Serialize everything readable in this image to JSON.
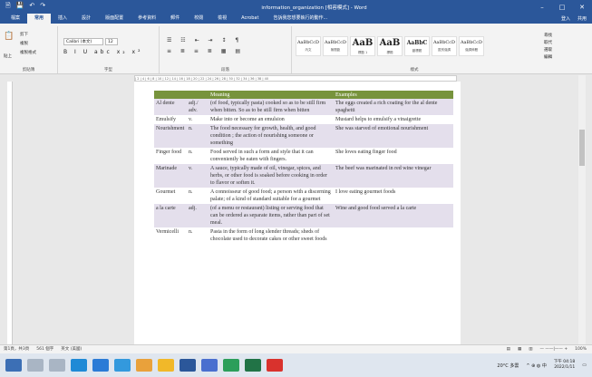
{
  "window": {
    "title": "information_organization [相容模式] - Word",
    "search_placeholder": "告訴我您想要執行的動作..."
  },
  "qat": [
    "🗎",
    "💾",
    "↶",
    "↷"
  ],
  "tabs": [
    "檔案",
    "常用",
    "插入",
    "設計",
    "版面配置",
    "參考資料",
    "郵件",
    "校閱",
    "檢視",
    "Acrobat"
  ],
  "tabs_right": [
    "登入",
    "共用"
  ],
  "ribbon": {
    "paste": "貼上",
    "cut": "剪下",
    "copy": "複製",
    "format_painter": "複製格式",
    "font_name": "Calibri (本文)",
    "font_size": "12",
    "format_buttons": "B I U abc x₂ x²",
    "groups": [
      "剪貼簿",
      "字型",
      "段落",
      "樣式",
      "編輯"
    ],
    "styles": [
      {
        "preview": "AaBbCcD",
        "label": "內文",
        "big": false
      },
      {
        "preview": "AaBbCcD",
        "label": "無間距",
        "big": false
      },
      {
        "preview": "AaB",
        "label": "標題 1",
        "big": true
      },
      {
        "preview": "AaB",
        "label": "標題",
        "big": true
      },
      {
        "preview": "AaBbC",
        "label": "副標題",
        "big": false
      },
      {
        "preview": "AaBbCcD",
        "label": "區別強調",
        "big": false
      },
      {
        "preview": "AaBbCcD",
        "label": "強調斜體",
        "big": false
      }
    ],
    "edit": [
      "尋找",
      "取代",
      "選取"
    ]
  },
  "table": {
    "headers": [
      "",
      "",
      "Meaning",
      "Examples"
    ],
    "rows": [
      {
        "word": "Al dente",
        "pos": "adj./ adv.",
        "meaning": "(of food, typically pasta) cooked so as to be still firm when bitten. So as to be still firm when bitten",
        "example": "The eggs created a rich coating for the al dente spaghetti"
      },
      {
        "word": "Emulsify",
        "pos": "v.",
        "meaning": "Make into or become an emulsion",
        "example": "Mustard helps to emulsify a vinaigrette"
      },
      {
        "word": "Nourishment",
        "pos": "n.",
        "meaning": "The food necessary for growth, health, and good condition ; the action of nourishing someone or something",
        "example": "She was starved of emotional nourishment"
      },
      {
        "word": "Finger food",
        "pos": "n.",
        "meaning": "Food served in such a form and style that it can conveniently be eaten with fingers.",
        "example": "She loves eating finger food"
      },
      {
        "word": "Marinade",
        "pos": "v.",
        "meaning": "A sauce, typically made of oil, vinegar, spices, and herbs, or other food is soaked before cooking in order to flavor or soften it.",
        "example": "The beef was marinated in red wine vinegar"
      },
      {
        "word": "Gourmet",
        "pos": "n.",
        "meaning": "A connoisseur of good food; a person with a discerning palate; of a kind of standard suitable for a gourmet",
        "example": "I love eating gourmet foods"
      },
      {
        "word": "a la carte",
        "pos": "adj.",
        "meaning": "(of a menu or restaurant) listing or serving food that can be ordered as separate items, rather than part of set meal.",
        "example": "Wine and good food served a la carte"
      },
      {
        "word": "Vermicelli",
        "pos": "n.",
        "meaning": "Pasta in the form of long slender threads; sheds of chocolate used to decorate cakes or other sweet foods",
        "example": ""
      }
    ]
  },
  "status": {
    "page": "第1頁，共3頁",
    "words": "561 個字",
    "lang": "英文 (美國)",
    "zoom": "100%"
  },
  "taskbar": {
    "weather": "20°C 多雲",
    "time": "下午 04:18",
    "date": "2022/1/11"
  }
}
